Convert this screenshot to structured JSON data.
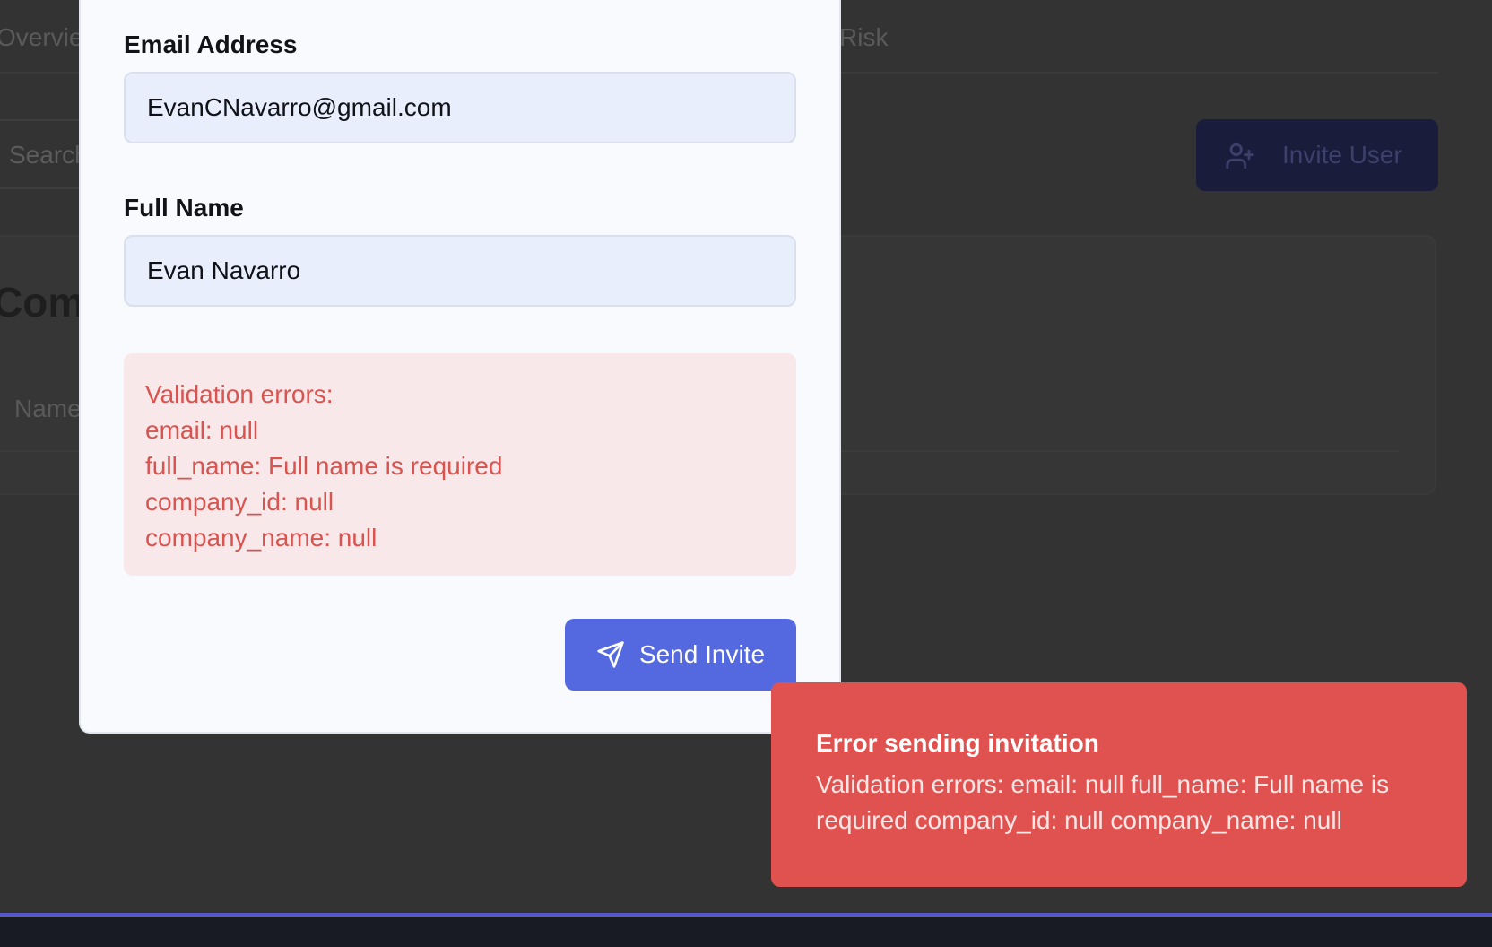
{
  "background": {
    "tabs": [
      {
        "label": "Overview"
      },
      {
        "label": "Risk"
      }
    ],
    "search": {
      "placeholder": "Search"
    },
    "invite_user_label": "Invite User",
    "card_title": "Companies",
    "column_name": "Name"
  },
  "modal": {
    "email": {
      "label": "Email Address",
      "value": "EvanCNavarro@gmail.com"
    },
    "full_name": {
      "label": "Full Name",
      "value": "Evan Navarro"
    },
    "errors": [
      "Validation errors:",
      "email: null",
      "full_name: Full name is required",
      "company_id: null",
      "company_name: null"
    ],
    "send_label": "Send Invite"
  },
  "toast": {
    "title": "Error sending invitation",
    "message": "Validation errors: email: null full_name: Full name is required company_id: null company_name: null"
  },
  "colors": {
    "overlay": "#333333",
    "primary": "#5469e0",
    "error_text": "#d9534f",
    "error_bg": "#f8e8ea",
    "toast_bg": "#df524f"
  },
  "icons": {
    "send": "send-icon",
    "invite": "user-plus-icon"
  }
}
